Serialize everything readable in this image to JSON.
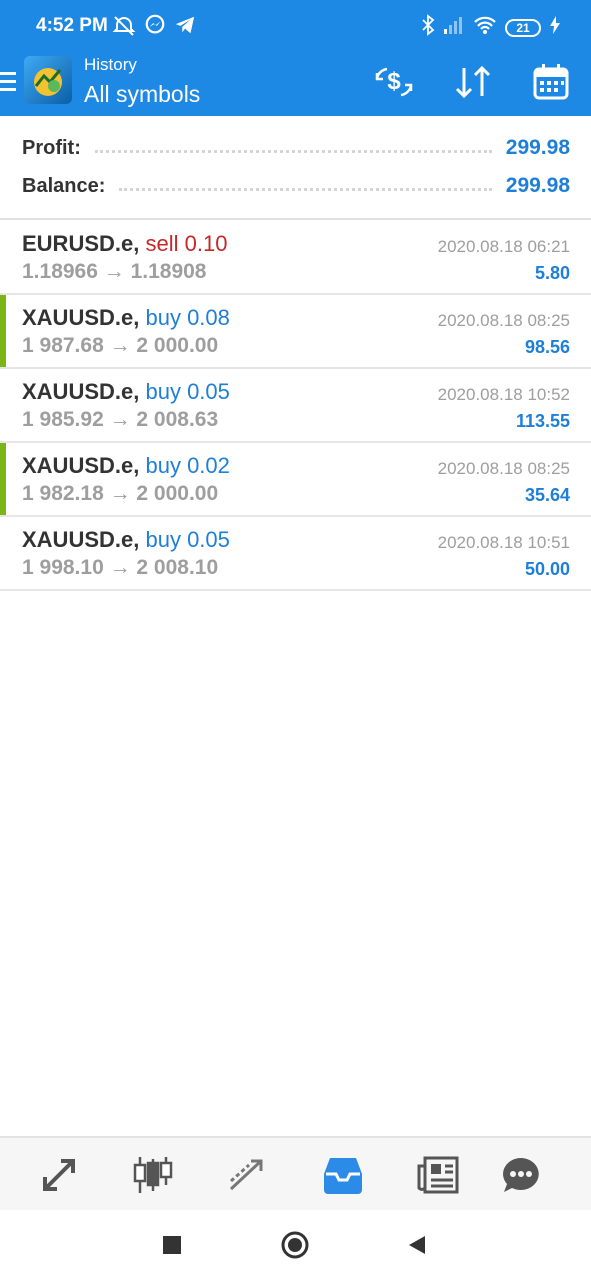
{
  "status_bar": {
    "time": "4:52 PM",
    "battery": "21",
    "icons": [
      "alarm-off-icon",
      "messenger-icon",
      "telegram-icon",
      "bluetooth-icon",
      "signal-icon",
      "wifi-icon",
      "battery-icon",
      "charging-icon"
    ]
  },
  "header": {
    "subtitle": "History",
    "title": "All symbols",
    "actions": [
      "currency-exchange-icon",
      "sort-icon",
      "calendar-icon"
    ]
  },
  "summary": {
    "profit_label": "Profit:",
    "profit_value": "299.98",
    "balance_label": "Balance:",
    "balance_value": "299.98"
  },
  "deals": [
    {
      "symbol": "EURUSD.e,",
      "side": "sell 0.10",
      "prices": "1.18966 → 1.18908",
      "time": "2020.08.18 06:21",
      "profit": "5.80"
    },
    {
      "symbol": "XAUUSD.e,",
      "side": "buy 0.08",
      "prices": "1 987.68 → 2 000.00",
      "time": "2020.08.18 08:25",
      "profit": "98.56"
    },
    {
      "symbol": "XAUUSD.e,",
      "side": "buy 0.05",
      "prices": "1 985.92 → 2 008.63",
      "time": "2020.08.18 10:52",
      "profit": "113.55"
    },
    {
      "symbol": "XAUUSD.e,",
      "side": "buy 0.02",
      "prices": "1 982.18 → 2 000.00",
      "time": "2020.08.18 08:25",
      "profit": "35.64"
    },
    {
      "symbol": "XAUUSD.e,",
      "side": "buy 0.05",
      "prices": "1 998.10 → 2 008.10",
      "time": "2020.08.18 10:51",
      "profit": "50.00"
    }
  ],
  "bottom_nav": {
    "items": [
      "quotes-icon",
      "chart-icon",
      "trade-icon",
      "history-icon",
      "news-icon",
      "chat-icon"
    ],
    "active": "history-icon"
  },
  "system_nav": [
    "recent-apps-icon",
    "home-icon",
    "back-icon"
  ],
  "colors": {
    "brand": "#1e88e5",
    "value_blue": "#1e7fd8",
    "sell_red": "#c62828",
    "buy_green_marker": "#7cb518",
    "muted": "#9e9e9e"
  }
}
